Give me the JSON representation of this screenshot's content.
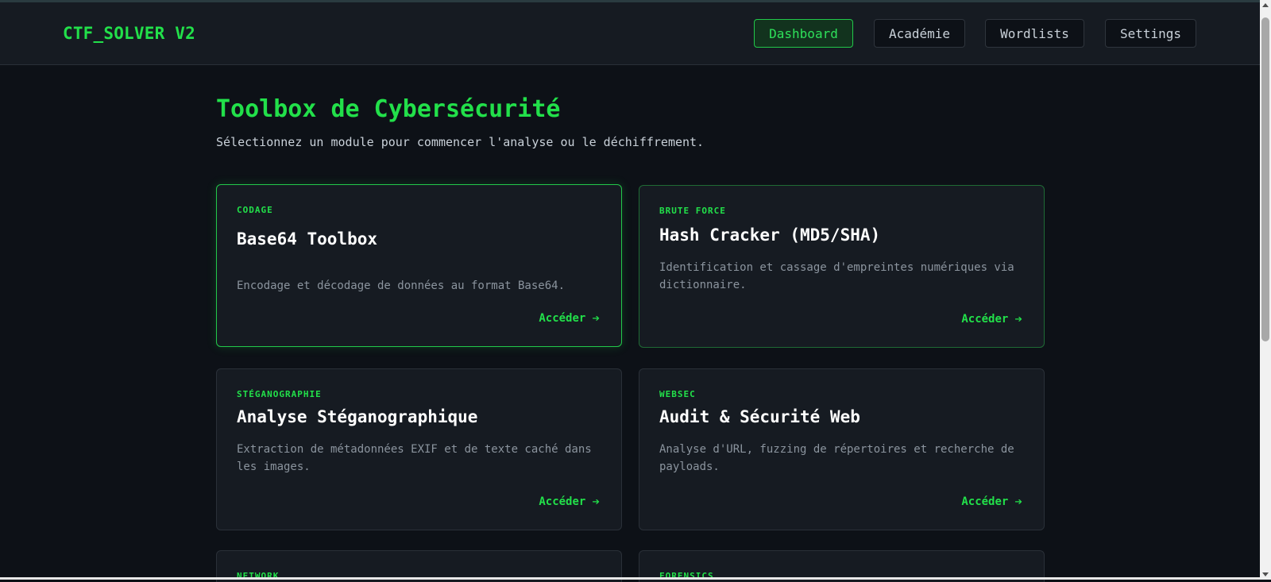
{
  "app": {
    "brand": "CTF_SOLVER V2"
  },
  "nav": {
    "items": [
      {
        "label": "Dashboard",
        "active": true
      },
      {
        "label": "Académie",
        "active": false
      },
      {
        "label": "Wordlists",
        "active": false
      },
      {
        "label": "Settings",
        "active": false
      }
    ]
  },
  "page": {
    "title": "Toolbox de Cybersécurité",
    "subtitle": "Sélectionnez un module pour commencer l'analyse ou le déchiffrement."
  },
  "cards": [
    {
      "tag": "CODAGE",
      "title": "Base64 Toolbox",
      "description": "Encodage et décodage de données au format Base64.",
      "cta": "Accéder",
      "arrow": "➔"
    },
    {
      "tag": "BRUTE FORCE",
      "title": "Hash Cracker (MD5/SHA)",
      "description": "Identification et cassage d'empreintes numériques via dictionnaire.",
      "cta": "Accéder",
      "arrow": "➔"
    },
    {
      "tag": "STÉGANOGRAPHIE",
      "title": "Analyse Stéganographique",
      "description": "Extraction de métadonnées EXIF et de texte caché dans les images.",
      "cta": "Accéder",
      "arrow": "➔"
    },
    {
      "tag": "WEBSEC",
      "title": "Audit & Sécurité Web",
      "description": "Analyse d'URL, fuzzing de répertoires et recherche de payloads.",
      "cta": "Accéder",
      "arrow": "➔"
    },
    {
      "tag": "NETWORK",
      "title": "",
      "description": "",
      "cta": "",
      "arrow": ""
    },
    {
      "tag": "FORENSICS",
      "title": "",
      "description": "",
      "cta": "",
      "arrow": ""
    }
  ],
  "colors": {
    "accent": "#22e04a",
    "background": "#0d1117",
    "card": "#161b22"
  }
}
